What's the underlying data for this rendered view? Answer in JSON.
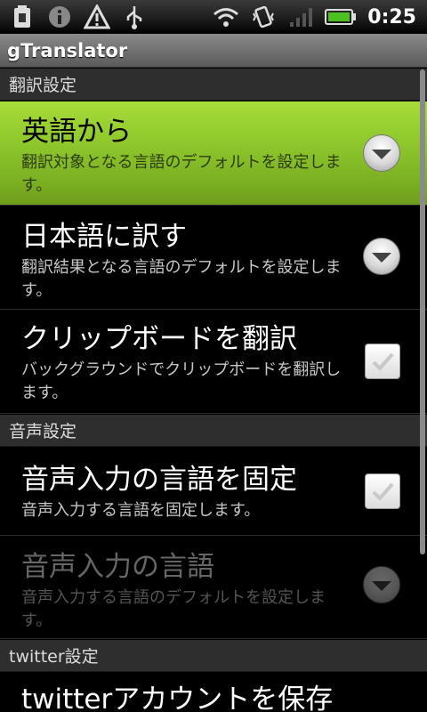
{
  "status_bar": {
    "time": "0:25",
    "left_icons": [
      "sd-card-icon",
      "info-icon",
      "warning-icon",
      "usb-icon"
    ],
    "right_icons": [
      "wifi-icon",
      "vibrate-icon",
      "signal-icon",
      "battery-icon"
    ]
  },
  "app": {
    "title": "gTranslator"
  },
  "sections": [
    {
      "header": "翻訳設定"
    },
    {
      "header": "音声設定"
    },
    {
      "header": "twitter設定"
    }
  ],
  "prefs": {
    "from_english": {
      "title": "英語から",
      "summary": "翻訳対象となる言語のデフォルトを設定します。",
      "widget": "dropdown",
      "selected": true
    },
    "to_japanese": {
      "title": "日本語に訳す",
      "summary": "翻訳結果となる言語のデフォルトを設定します。",
      "widget": "dropdown"
    },
    "clipboard": {
      "title": "クリップボードを翻訳",
      "summary": "バックグラウンドでクリップボードを翻訳します。",
      "widget": "checkbox",
      "checked": true
    },
    "voice_fixed": {
      "title": "音声入力の言語を固定",
      "summary": "音声入力する言語を固定します。",
      "widget": "checkbox",
      "checked": true
    },
    "voice_lang": {
      "title": "音声入力の言語",
      "summary": "音声入力する言語のデフォルトを設定します。",
      "widget": "dropdown",
      "disabled": true
    },
    "twitter_save": {
      "title": "twitterアカウントを保存"
    }
  },
  "colors": {
    "selected_bg": "#8ec82c",
    "background": "#000000",
    "section_bg": "#2e2e2e"
  }
}
